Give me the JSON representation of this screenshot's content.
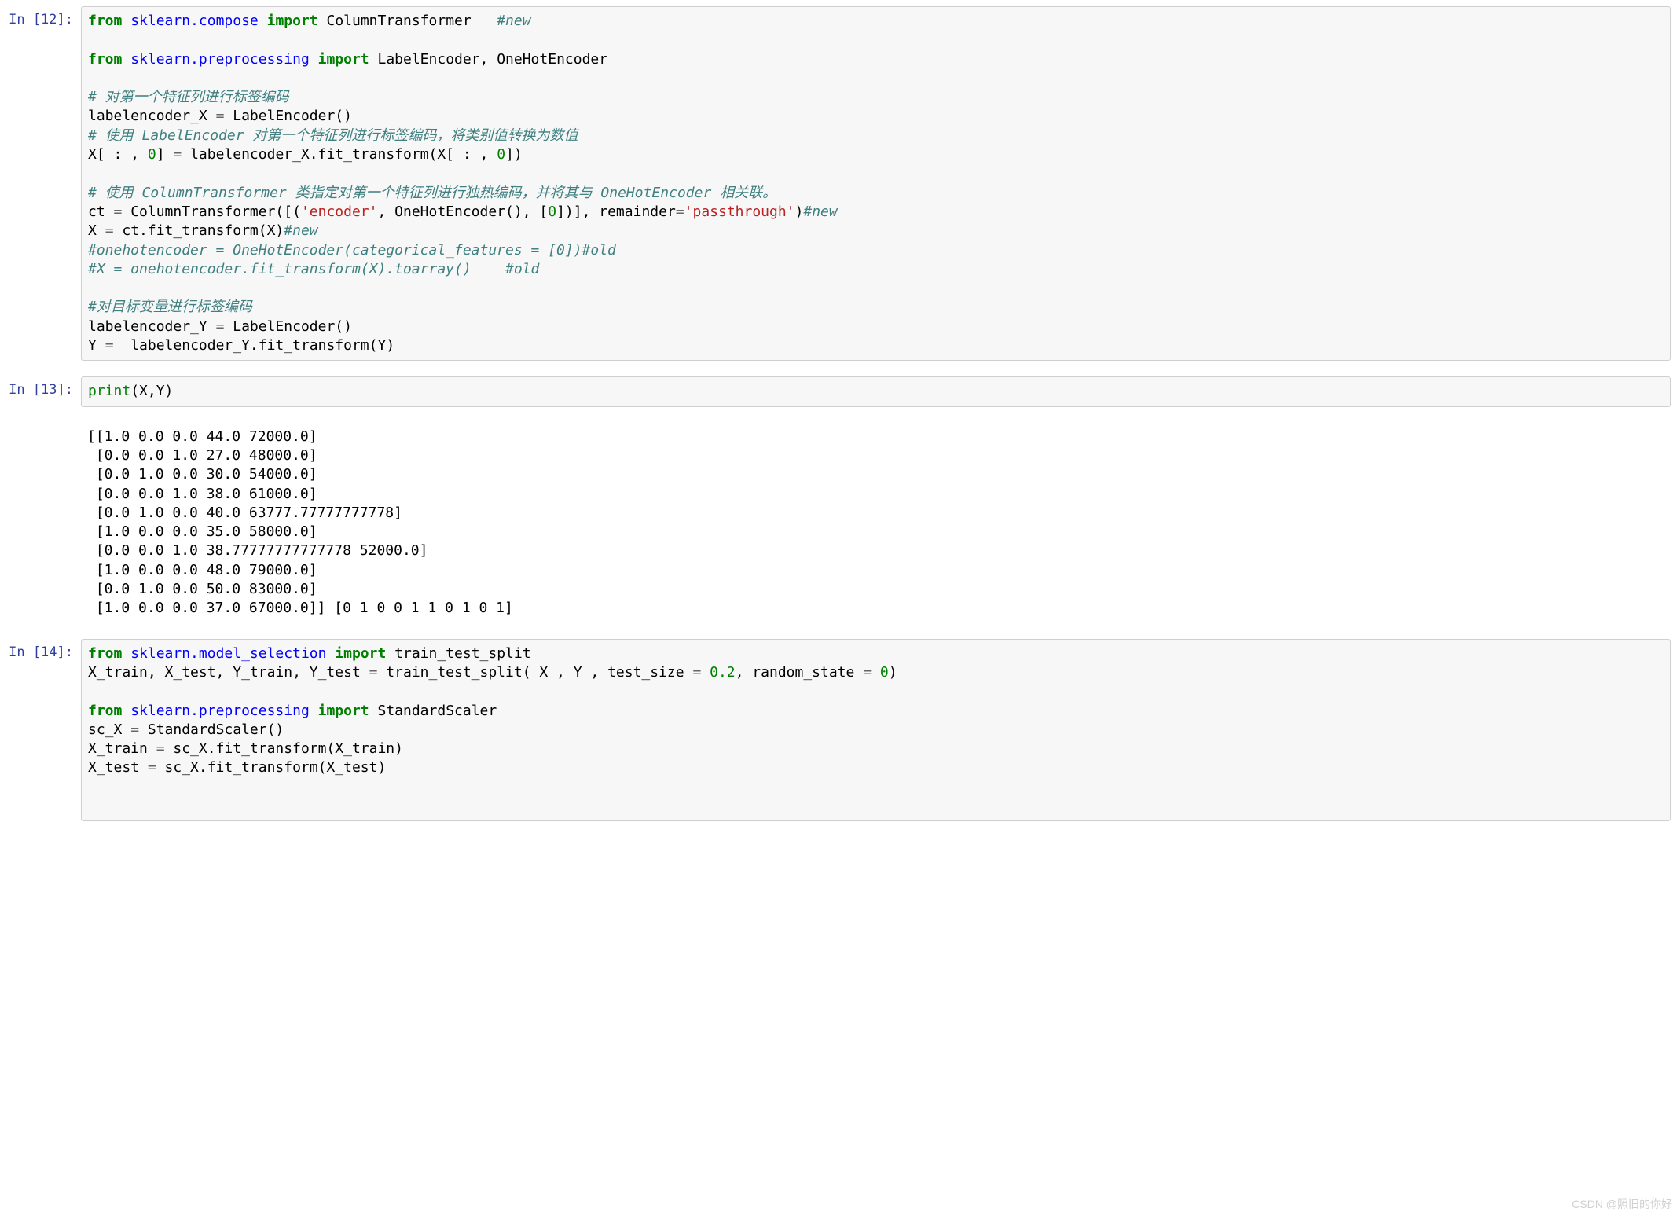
{
  "cells": [
    {
      "prompt_label": "In [12]:",
      "code_html": "<span class=\"kw\">from</span> <span class=\"nn\">sklearn.compose</span> <span class=\"kw\">import</span> ColumnTransformer   <span class=\"cm\">#new</span>\n\n<span class=\"kw\">from</span> <span class=\"nn\">sklearn.preprocessing</span> <span class=\"kw\">import</span> LabelEncoder, OneHotEncoder\n\n<span class=\"cm\"># 对第一个特征列进行标签编码</span>\nlabelencoder_X <span class=\"op\">=</span> LabelEncoder()\n<span class=\"cm\"># 使用 LabelEncoder 对第一个特征列进行标签编码，将类别值转换为数值</span>\nX[ : , <span class=\"num\">0</span>] <span class=\"op\">=</span> labelencoder_X.fit_transform(X[ : , <span class=\"num\">0</span>])\n\n<span class=\"cm\"># 使用 ColumnTransformer 类指定对第一个特征列进行独热编码，并将其与 OneHotEncoder 相关联。</span>\nct <span class=\"op\">=</span> ColumnTransformer([(<span class=\"st\">'encoder'</span>, OneHotEncoder(), [<span class=\"num\">0</span>])], remainder<span class=\"op\">=</span><span class=\"st\">'passthrough'</span>)<span class=\"cm\">#new</span>\nX <span class=\"op\">=</span> ct.fit_transform(X)<span class=\"cm\">#new</span>\n<span class=\"cm\">#onehotencoder = OneHotEncoder(categorical_features = [0])#old</span>\n<span class=\"cm\">#X = onehotencoder.fit_transform(X).toarray()    #old</span>\n\n<span class=\"cm\">#对目标变量进行标签编码</span>\nlabelencoder_Y <span class=\"op\">=</span> LabelEncoder()\nY <span class=\"op\">=</span>  labelencoder_Y.fit_transform(Y)"
    },
    {
      "prompt_label": "In [13]:",
      "code_html": "<span class=\"nb\">print</span>(X,Y)",
      "output_text": "[[1.0 0.0 0.0 44.0 72000.0]\n [0.0 0.0 1.0 27.0 48000.0]\n [0.0 1.0 0.0 30.0 54000.0]\n [0.0 0.0 1.0 38.0 61000.0]\n [0.0 1.0 0.0 40.0 63777.77777777778]\n [1.0 0.0 0.0 35.0 58000.0]\n [0.0 0.0 1.0 38.77777777777778 52000.0]\n [1.0 0.0 0.0 48.0 79000.0]\n [0.0 1.0 0.0 50.0 83000.0]\n [1.0 0.0 0.0 37.0 67000.0]] [0 1 0 0 1 1 0 1 0 1]"
    },
    {
      "prompt_label": "In [14]:",
      "code_html": "<span class=\"kw\">from</span> <span class=\"nn\">sklearn.model_selection</span> <span class=\"kw\">import</span> train_test_split\nX_train, X_test, Y_train, Y_test <span class=\"op\">=</span> train_test_split( X , Y , test_size <span class=\"op\">=</span> <span class=\"num\">0.2</span>, random_state <span class=\"op\">=</span> <span class=\"num\">0</span>)\n\n<span class=\"kw\">from</span> <span class=\"nn\">sklearn.preprocessing</span> <span class=\"kw\">import</span> StandardScaler\nsc_X <span class=\"op\">=</span> StandardScaler()\nX_train <span class=\"op\">=</span> sc_X.fit_transform(X_train)\nX_test <span class=\"op\">=</span> sc_X.fit_transform(X_test)\n\n\n"
    }
  ],
  "watermark": "CSDN @照旧的你好"
}
